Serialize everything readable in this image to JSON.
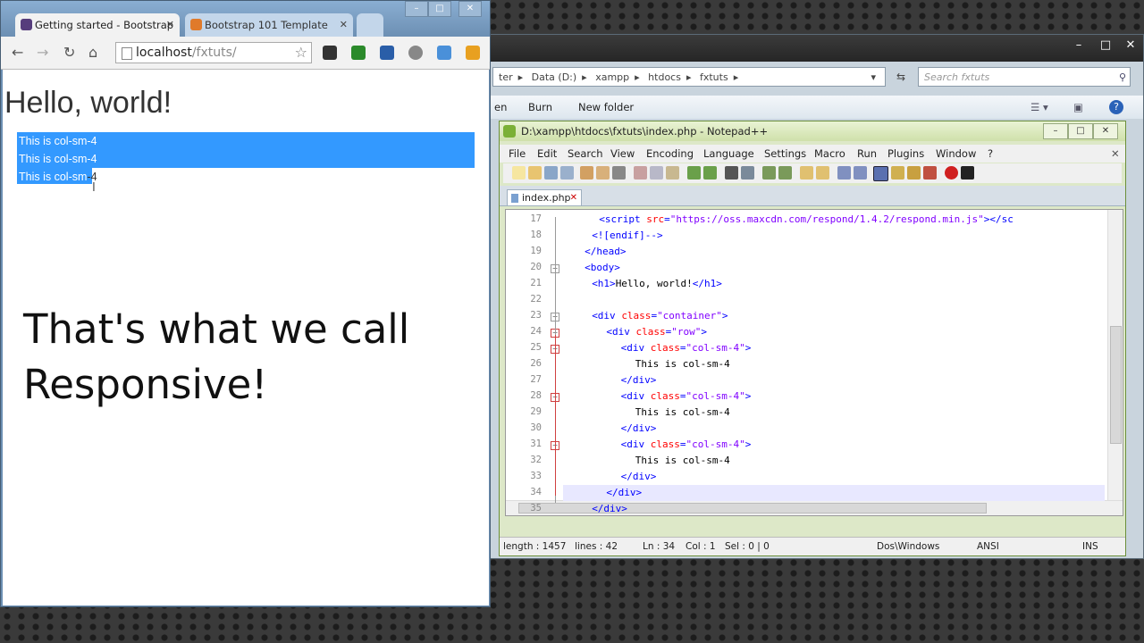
{
  "explorer": {
    "breadcrumb": [
      "ter",
      "Data (D:)",
      "xampp",
      "htdocs",
      "fxtuts"
    ],
    "search_placeholder": "Search fxtuts",
    "commands": [
      "en",
      "Burn",
      "New folder"
    ]
  },
  "notepad": {
    "title": "D:\\xampp\\htdocs\\fxtuts\\index.php - Notepad++",
    "menu": [
      "File",
      "Edit",
      "Search",
      "View",
      "Encoding",
      "Language",
      "Settings",
      "Macro",
      "Run",
      "Plugins",
      "Window",
      "?"
    ],
    "tab": "index.php",
    "lines": [
      {
        "n": "17",
        "indent": 3,
        "parts": [
          [
            "tag",
            "<script "
          ],
          [
            "attr",
            "src"
          ],
          [
            "tag",
            "="
          ],
          [
            "str",
            "\"https://oss.maxcdn.com/respond/1.4.2/respond.min.js\""
          ],
          [
            "tag",
            "></sc"
          ]
        ]
      },
      {
        "n": "18",
        "indent": 2,
        "parts": [
          [
            "tag",
            "<![endif]-->"
          ]
        ]
      },
      {
        "n": "19",
        "indent": 1,
        "parts": [
          [
            "tag",
            "</head>"
          ]
        ]
      },
      {
        "n": "20",
        "indent": 1,
        "parts": [
          [
            "tag",
            "<body>"
          ]
        ]
      },
      {
        "n": "21",
        "indent": 2,
        "parts": [
          [
            "tag",
            "<h1>"
          ],
          [
            "txt",
            "Hello, world!"
          ],
          [
            "tag",
            "</h1>"
          ]
        ]
      },
      {
        "n": "22",
        "indent": 0,
        "parts": []
      },
      {
        "n": "23",
        "indent": 2,
        "parts": [
          [
            "tag",
            "<div "
          ],
          [
            "attr",
            "class"
          ],
          [
            "tag",
            "="
          ],
          [
            "str",
            "\"container\""
          ],
          [
            "tag",
            ">"
          ]
        ]
      },
      {
        "n": "24",
        "indent": 4,
        "parts": [
          [
            "tag",
            "<div "
          ],
          [
            "attr",
            "class"
          ],
          [
            "tag",
            "="
          ],
          [
            "str",
            "\"row\""
          ],
          [
            "tag",
            ">"
          ]
        ]
      },
      {
        "n": "25",
        "indent": 6,
        "parts": [
          [
            "tag",
            "<div "
          ],
          [
            "attr",
            "class"
          ],
          [
            "tag",
            "="
          ],
          [
            "str",
            "\"col-sm-4\""
          ],
          [
            "tag",
            ">"
          ]
        ]
      },
      {
        "n": "26",
        "indent": 8,
        "parts": [
          [
            "txt",
            "This is col-sm-4"
          ]
        ]
      },
      {
        "n": "27",
        "indent": 6,
        "parts": [
          [
            "tag",
            "</div>"
          ]
        ]
      },
      {
        "n": "28",
        "indent": 6,
        "parts": [
          [
            "tag",
            "<div "
          ],
          [
            "attr",
            "class"
          ],
          [
            "tag",
            "="
          ],
          [
            "str",
            "\"col-sm-4\""
          ],
          [
            "tag",
            ">"
          ]
        ]
      },
      {
        "n": "29",
        "indent": 8,
        "parts": [
          [
            "txt",
            "This is col-sm-4"
          ]
        ]
      },
      {
        "n": "30",
        "indent": 6,
        "parts": [
          [
            "tag",
            "</div>"
          ]
        ]
      },
      {
        "n": "31",
        "indent": 6,
        "parts": [
          [
            "tag",
            "<div "
          ],
          [
            "attr",
            "class"
          ],
          [
            "tag",
            "="
          ],
          [
            "str",
            "\"col-sm-4\""
          ],
          [
            "tag",
            ">"
          ]
        ]
      },
      {
        "n": "32",
        "indent": 8,
        "parts": [
          [
            "txt",
            "This is col-sm-4"
          ]
        ]
      },
      {
        "n": "33",
        "indent": 6,
        "parts": [
          [
            "tag",
            "</div>"
          ]
        ]
      },
      {
        "n": "34",
        "indent": 4,
        "parts": [
          [
            "tag",
            "</div>"
          ]
        ]
      },
      {
        "n": "35",
        "indent": 2,
        "parts": [
          [
            "tag",
            "</div>"
          ]
        ]
      }
    ],
    "status": {
      "length": "length : 1457",
      "lines": "lines : 42",
      "ln": "Ln : 34",
      "col": "Col : 1",
      "sel": "Sel : 0 | 0",
      "eol": "Dos\\Windows",
      "encoding": "ANSI",
      "mode": "INS"
    }
  },
  "chrome": {
    "tabs": [
      "Getting started - Bootstrap",
      "Bootstrap 101 Template"
    ],
    "url_host": "localhost",
    "url_path": "/fxtuts/",
    "page": {
      "heading": "Hello, world!",
      "columns": [
        "This is col-sm-4",
        "This is col-sm-4",
        "This is col-sm-4"
      ]
    }
  },
  "overlay_caption": [
    "That's what we call",
    "Responsive!"
  ]
}
